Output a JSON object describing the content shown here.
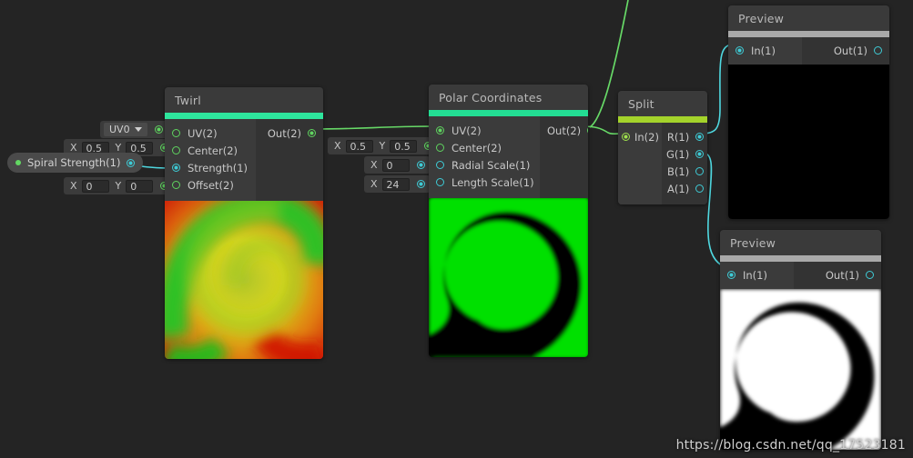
{
  "canvas": {
    "background": "#242424"
  },
  "watermark": {
    "text": "https://blog.csdn.net/qq_17523181"
  },
  "nodes": {
    "twirl": {
      "title": "Twirl",
      "accent_color": "#2ee59d",
      "inputs": [
        {
          "label": "UV(2)",
          "connected": false,
          "color": "#5fd35f"
        },
        {
          "label": "Center(2)",
          "connected": false,
          "color": "#5fd35f"
        },
        {
          "label": "Strength(1)",
          "connected": true,
          "color": "#3ecbd6"
        },
        {
          "label": "Offset(2)",
          "connected": false,
          "color": "#5fd35f"
        }
      ],
      "outputs": [
        {
          "label": "Out(2)",
          "connected": true,
          "color": "#5fd35f"
        }
      ],
      "preview": "twirl-gradient-spiral"
    },
    "polar": {
      "title": "Polar Coordinates",
      "accent_color": "#23dd93",
      "inputs": [
        {
          "label": "UV(2)",
          "connected": true,
          "color": "#5fd35f"
        },
        {
          "label": "Center(2)",
          "connected": false,
          "color": "#5fd35f"
        },
        {
          "label": "Radial Scale(1)",
          "connected": false,
          "color": "#3ecbd6"
        },
        {
          "label": "Length Scale(1)",
          "connected": false,
          "color": "#3ecbd6"
        }
      ],
      "outputs": [
        {
          "label": "Out(2)",
          "connected": true,
          "color": "#5fd35f"
        }
      ],
      "preview": "green-black-spiral"
    },
    "split": {
      "title": "Split",
      "accent_color": "#a4d32b",
      "inputs": [
        {
          "label": "In(2)",
          "connected": true,
          "color": "#9fe04c"
        }
      ],
      "outputs": [
        {
          "label": "R(1)",
          "connected": true,
          "color": "#3ecbd6"
        },
        {
          "label": "G(1)",
          "connected": true,
          "color": "#3ecbd6"
        },
        {
          "label": "B(1)",
          "connected": false,
          "color": "#3ecbd6"
        },
        {
          "label": "A(1)",
          "connected": false,
          "color": "#3ecbd6"
        }
      ]
    },
    "preview_top": {
      "title": "Preview",
      "accent_color": "#a9a9a9",
      "inputs": [
        {
          "label": "In(1)",
          "connected": true,
          "color": "#3ecbd6"
        }
      ],
      "outputs": [
        {
          "label": "Out(1)",
          "connected": false,
          "color": "#3ecbd6"
        }
      ],
      "preview": "black"
    },
    "preview_bottom": {
      "title": "Preview",
      "accent_color": "#a9a9a9",
      "inputs": [
        {
          "label": "In(1)",
          "connected": true,
          "color": "#3ecbd6"
        }
      ],
      "outputs": [
        {
          "label": "Out(1)",
          "connected": false,
          "color": "#3ecbd6"
        }
      ],
      "preview": "white-black-spiral"
    }
  },
  "widgets": {
    "twirl_uv": {
      "selected": "UV0"
    },
    "twirl_center": {
      "x_label": "X",
      "x_value": "0.5",
      "y_label": "Y",
      "y_value": "0.5"
    },
    "twirl_offset": {
      "x_label": "X",
      "x_value": "0",
      "y_label": "Y",
      "y_value": "0"
    },
    "polar_center": {
      "x_label": "X",
      "x_value": "0.5",
      "y_label": "Y",
      "y_value": "0.5"
    },
    "polar_radial": {
      "x_label": "X",
      "x_value": "0"
    },
    "polar_length": {
      "x_label": "X",
      "x_value": "24"
    }
  },
  "properties": {
    "spiral_strength": {
      "label": "Spiral Strength(1)"
    }
  }
}
